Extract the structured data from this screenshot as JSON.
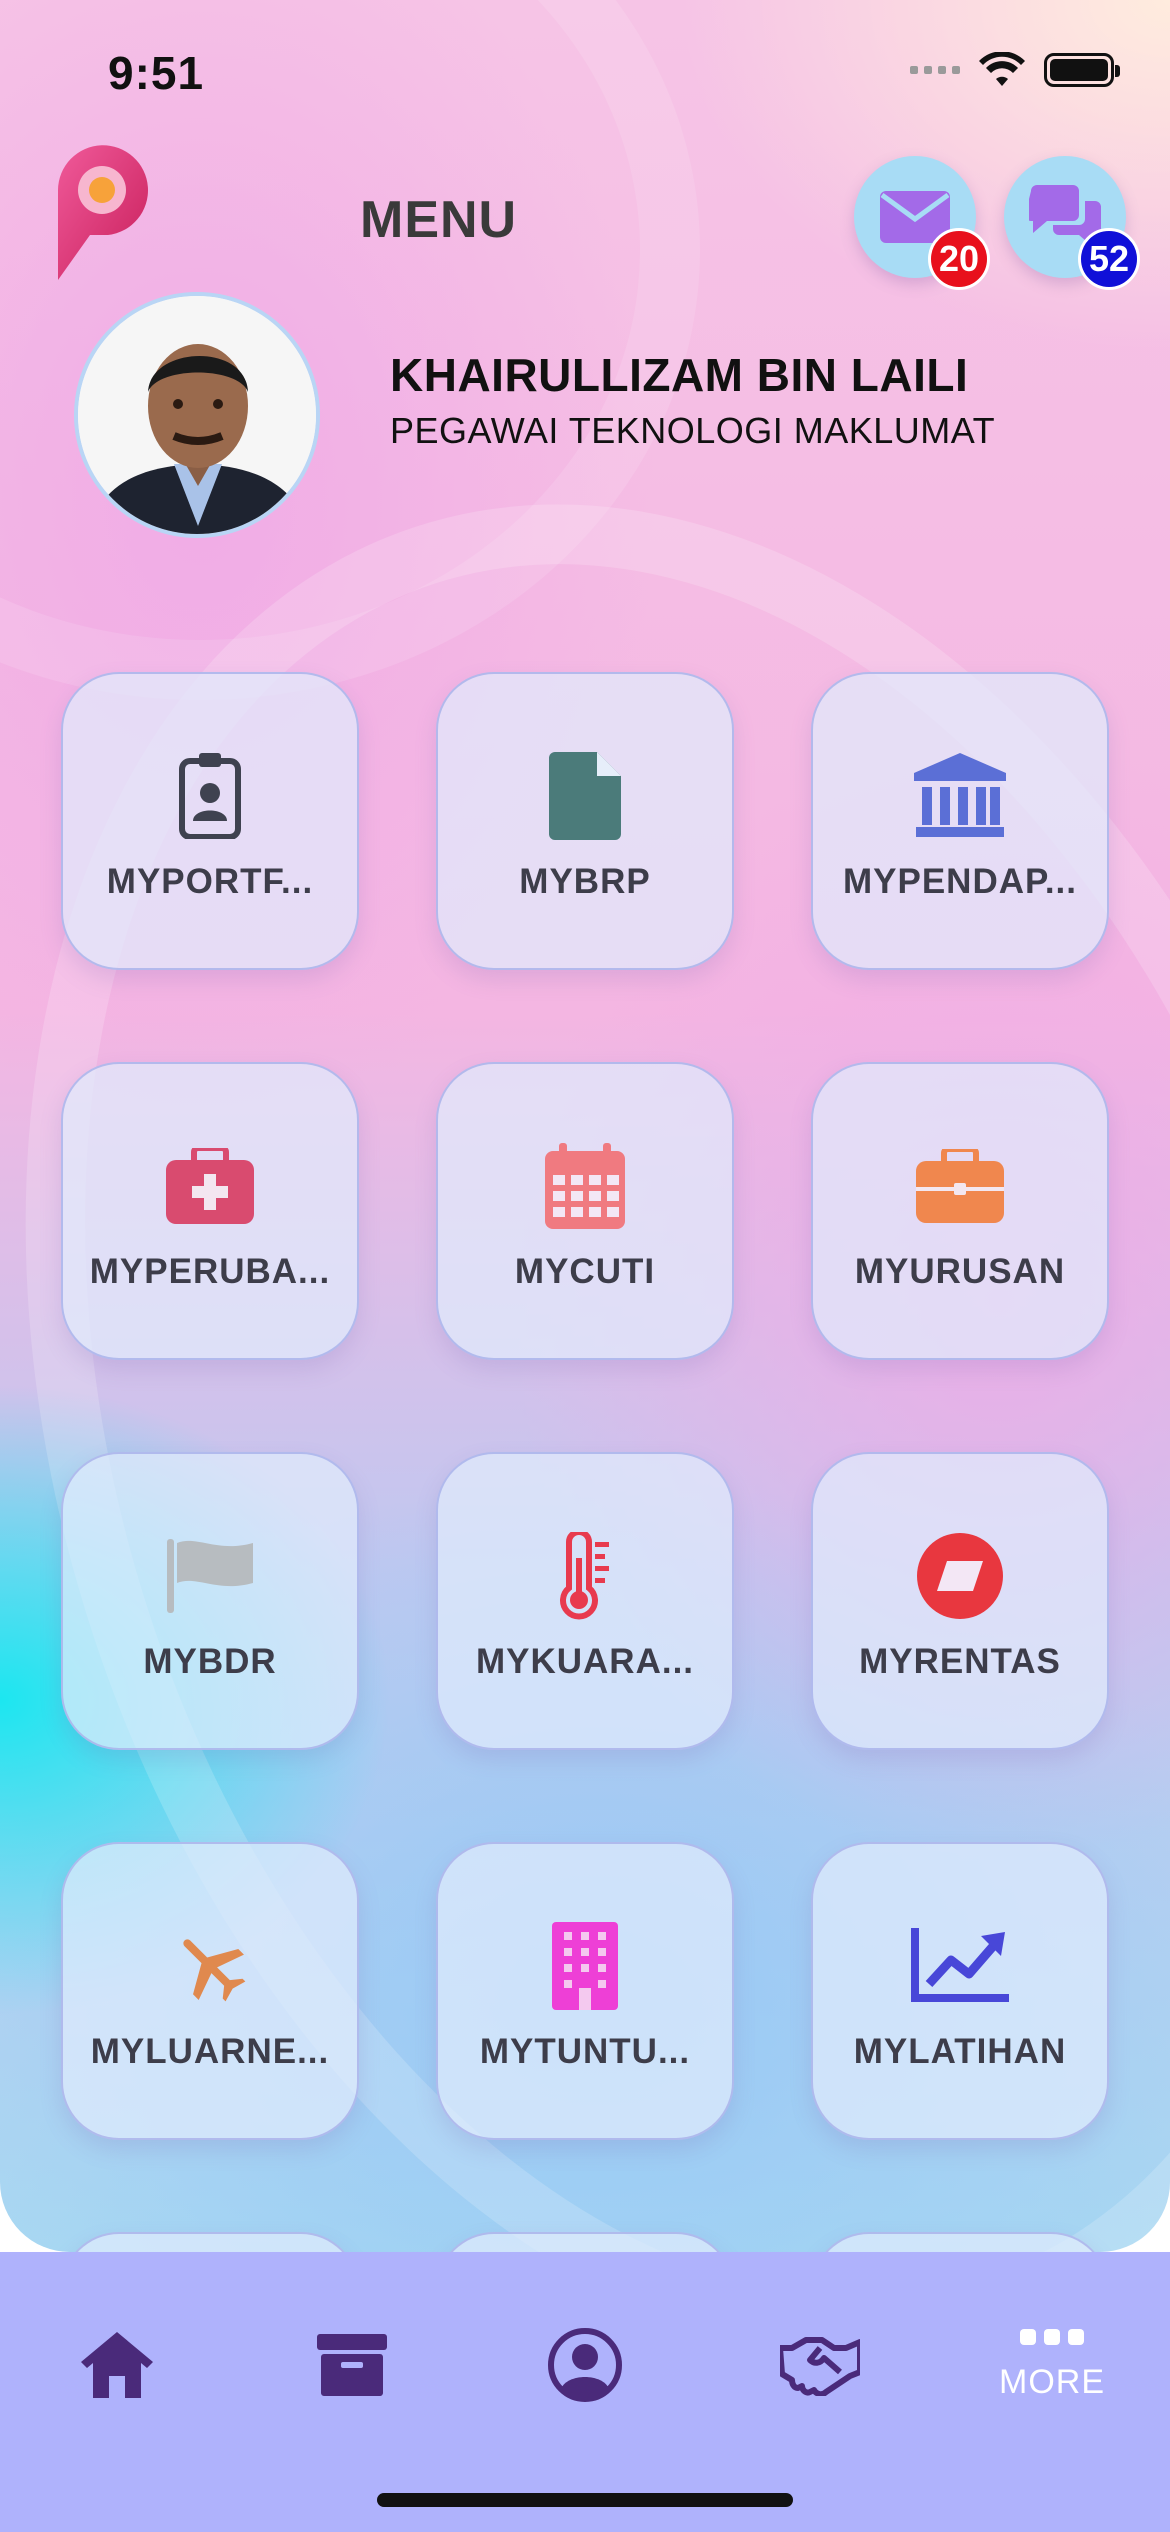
{
  "status_bar": {
    "time": "9:51"
  },
  "header": {
    "title": "MENU",
    "mail_badge": "20",
    "chat_badge": "52"
  },
  "profile": {
    "name": "KHAIRULLIZAM BIN LAILI",
    "role": "PEGAWAI TEKNOLOGI MAKLUMAT"
  },
  "menu_items": [
    {
      "label": "MYPORTF...",
      "icon": "id-badge-icon",
      "color": "#3f4250"
    },
    {
      "label": "MYBRP",
      "icon": "file-icon",
      "color": "#4b7b7a"
    },
    {
      "label": "MYPENDAP...",
      "icon": "bank-icon",
      "color": "#5b6fd6"
    },
    {
      "label": "MYPERUBA...",
      "icon": "medical-kit-icon",
      "color": "#d94b6f"
    },
    {
      "label": "MYCUTI",
      "icon": "calendar-icon",
      "color": "#f07a80"
    },
    {
      "label": "MYURUSAN",
      "icon": "briefcase-icon",
      "color": "#f0874e"
    },
    {
      "label": "MYBDR",
      "icon": "flag-icon",
      "color": "#b7bcc0"
    },
    {
      "label": "MYKUARA...",
      "icon": "thermometer-icon",
      "color": "#e83a4e"
    },
    {
      "label": "MYRENTAS",
      "icon": "rentas-icon",
      "color": "#e8373f"
    },
    {
      "label": "MYLUARNE...",
      "icon": "airplane-icon",
      "color": "#e0894e"
    },
    {
      "label": "MYTUNTU...",
      "icon": "building-icon",
      "color": "#ee3fd6"
    },
    {
      "label": "MYLATIHAN",
      "icon": "chart-line-icon",
      "color": "#4847d8"
    }
  ],
  "tabbar": {
    "more_label": "MORE"
  },
  "colors": {
    "tab_background": "#afb2fc",
    "tab_icon": "#4a2a7a",
    "mail_badge": "#e8101c",
    "chat_badge": "#1010d8"
  }
}
